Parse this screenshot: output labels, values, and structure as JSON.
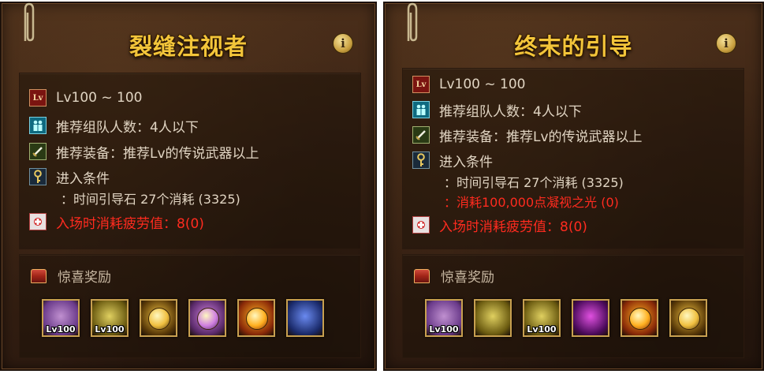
{
  "panels": [
    {
      "title": "裂缝注视者",
      "info_label": "i",
      "level": "Lv100 ~ 100",
      "party": "推荐组队人数：4人以下",
      "equip": "推荐装备：推荐Lv的传说武器以上",
      "entry_title": "进入条件",
      "entry_cond1": "：时间引导石 27个消耗 (3325)",
      "fatigue": "入场时消耗疲劳值：8(0)",
      "reward_label": "惊喜奖励",
      "rewards": [
        {
          "name": "epic-weapon-box",
          "tag": "Lv100",
          "colors": [
            "#6a3a8a",
            "#c090d0"
          ]
        },
        {
          "name": "epic-weapon-box-gold",
          "tag": "Lv100",
          "colors": [
            "#6a5a10",
            "#e0d060"
          ]
        },
        {
          "name": "gold-medal",
          "colors": [
            "#5a3a08",
            "#f0c040"
          ]
        },
        {
          "name": "rainbow-orb",
          "colors": [
            "#5a2a6a",
            "#d080e0"
          ]
        },
        {
          "name": "fire-orb",
          "colors": [
            "#8a2a08",
            "#ffb020"
          ]
        },
        {
          "name": "blue-crystal",
          "colors": [
            "#1a2a6a",
            "#6a8af0"
          ]
        }
      ]
    },
    {
      "title": "终末的引导",
      "info_label": "i",
      "level": "Lv100 ~ 100",
      "party": "推荐组队人数：4人以下",
      "equip": "推荐装备：推荐Lv的传说武器以上",
      "entry_title": "进入条件",
      "entry_cond1": "：时间引导石 27个消耗 (3325)",
      "entry_cond2": "：消耗100,000点凝视之光 (0)",
      "fatigue": "入场时消耗疲劳值：8(0)",
      "reward_label": "惊喜奖励",
      "rewards": [
        {
          "name": "epic-weapon-box",
          "tag": "Lv100",
          "colors": [
            "#6a3a8a",
            "#c090d0"
          ]
        },
        {
          "name": "weapon-box-gold",
          "colors": [
            "#6a5a10",
            "#e0d060"
          ]
        },
        {
          "name": "epic-weapon-box-gold",
          "tag": "Lv100",
          "colors": [
            "#6a5a10",
            "#e0d060"
          ]
        },
        {
          "name": "purple-swirl",
          "colors": [
            "#4a0a5a",
            "#e050e0"
          ]
        },
        {
          "name": "fire-orb",
          "colors": [
            "#8a2a08",
            "#ffb020"
          ]
        },
        {
          "name": "gold-medal",
          "colors": [
            "#5a3a08",
            "#f0c040"
          ]
        }
      ]
    }
  ]
}
